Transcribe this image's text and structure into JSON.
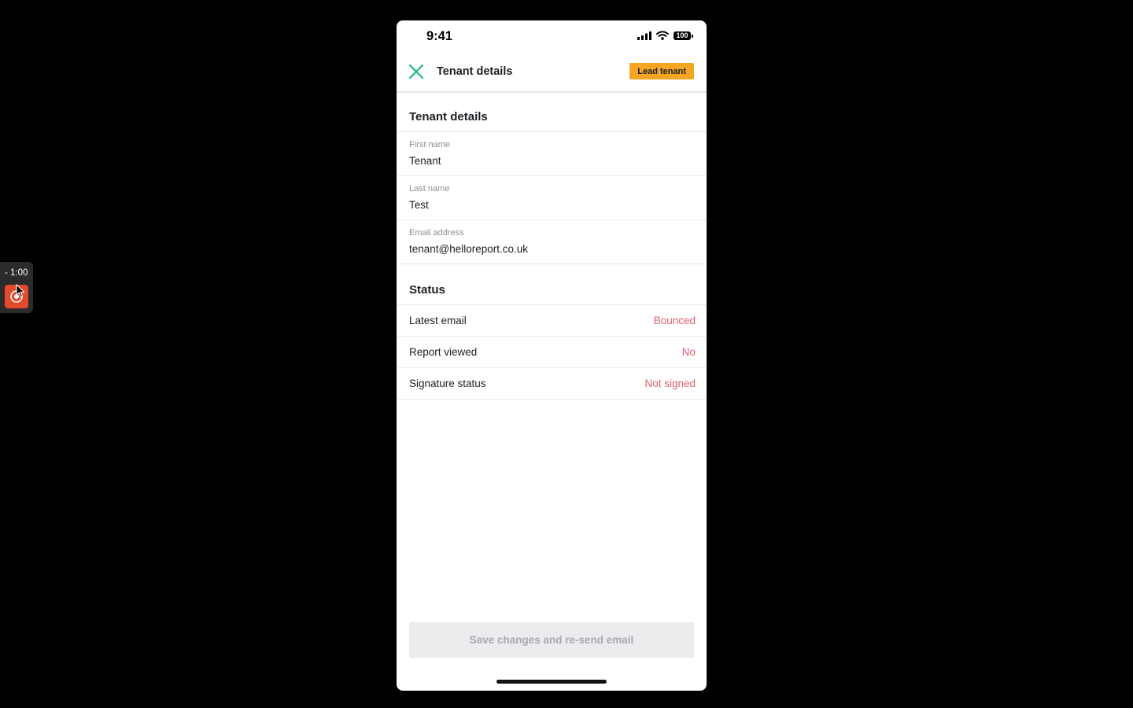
{
  "recorder": {
    "time": "- 1:00"
  },
  "status_bar": {
    "time": "9:41",
    "battery": "100"
  },
  "nav": {
    "title": "Tenant details",
    "badge": "Lead tenant"
  },
  "tenant_section": {
    "title": "Tenant details",
    "fields": [
      {
        "label": "First name",
        "value": "Tenant"
      },
      {
        "label": "Last name",
        "value": "Test"
      },
      {
        "label": "Email address",
        "value": "tenant@helloreport.co.uk"
      }
    ]
  },
  "status_section": {
    "title": "Status",
    "rows": [
      {
        "label": "Latest email",
        "value": "Bounced"
      },
      {
        "label": "Report viewed",
        "value": "No"
      },
      {
        "label": "Signature status",
        "value": "Not signed"
      }
    ]
  },
  "actions": {
    "save_label": "Save changes and re-send email"
  },
  "colors": {
    "accent_green": "#1fb784",
    "badge_orange": "#f5a524",
    "status_red": "#e2606b",
    "disabled_bg": "#ececef",
    "disabled_text": "#a6a9af"
  }
}
